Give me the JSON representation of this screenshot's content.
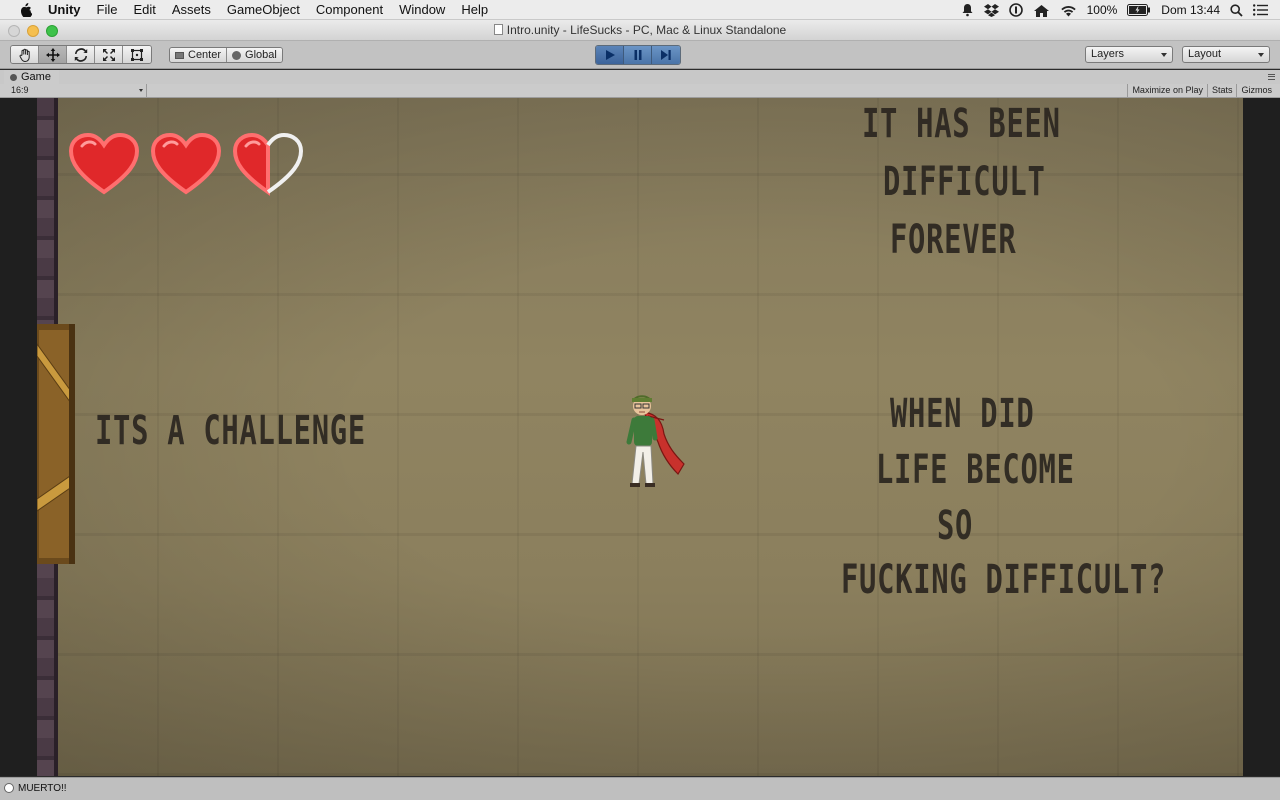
{
  "menubar": {
    "app_name": "Unity",
    "menus": [
      "File",
      "Edit",
      "Assets",
      "GameObject",
      "Component",
      "Window",
      "Help"
    ],
    "battery": "100%",
    "clock": "Dom 13:44"
  },
  "window": {
    "title": "Intro.unity - LifeSucks - PC, Mac & Linux Standalone"
  },
  "toolbar": {
    "pivot_mode": "Center",
    "pivot_rotation": "Global",
    "layers_label": "Layers",
    "layout_label": "Layout"
  },
  "game_tab": {
    "label": "Game",
    "aspect": "16:9",
    "maximize_on_play": "Maximize on Play",
    "stats": "Stats",
    "gizmos": "Gizmos"
  },
  "game": {
    "text_top_right": [
      "IT HAS BEEN",
      "DIFFICULT",
      "FOREVER"
    ],
    "text_left": "ITS A CHALLENGE",
    "text_mid_right": [
      "WHEN DID",
      "LIFE BECOME",
      "SO",
      "FUCKING DIFFICULT?"
    ],
    "health": {
      "full_hearts": 2,
      "half_hearts": 1,
      "max_hearts": 3
    }
  },
  "status": {
    "message": "MUERTO!!"
  }
}
